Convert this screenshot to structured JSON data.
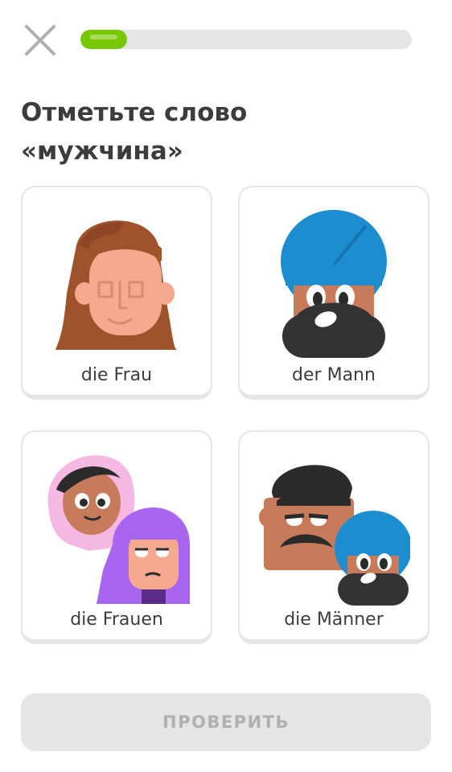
{
  "header": {
    "close_icon": "close-x-icon",
    "progress_fraction": 0.14,
    "colors": {
      "progress_fill": "#78c800",
      "progress_track": "#e5e5e5"
    }
  },
  "prompt": {
    "line1": "Отметьте слово",
    "line2": "«мужчина»"
  },
  "choices": [
    {
      "label": "die Frau",
      "image": "woman-illustration"
    },
    {
      "label": "der Mann",
      "image": "man-turban-illustration"
    },
    {
      "label": "die Frauen",
      "image": "women-illustration"
    },
    {
      "label": "die Männer",
      "image": "men-illustration"
    }
  ],
  "footer": {
    "check_label": "ПРОВЕРИТЬ",
    "check_state": "disabled"
  },
  "colors": {
    "text": "#3c3c3c",
    "border": "#e5e5e5",
    "disabled_button": "#e5e5e5",
    "disabled_text": "#afafaf"
  }
}
